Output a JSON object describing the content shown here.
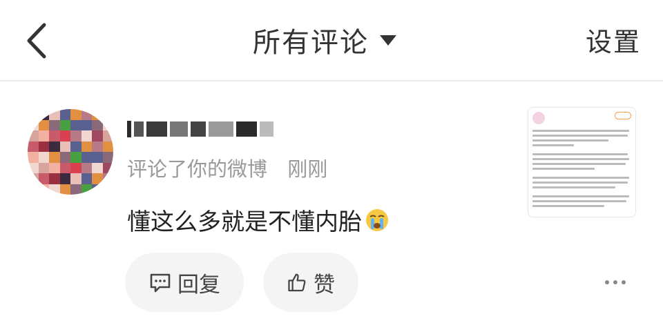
{
  "header": {
    "title": "所有评论",
    "settings_label": "设置",
    "back_icon": "chevron-left-icon",
    "dropdown_icon": "caret-down-icon"
  },
  "notification": {
    "meta_action": "评论了你的微博",
    "meta_time": "刚刚",
    "comment_text": "懂这么多就是不懂内胎",
    "comment_emoji": "crying-face-icon",
    "actions": {
      "reply_label": "回复",
      "like_label": "赞"
    },
    "more_icon": "more-dots-icon"
  },
  "colors": {
    "text_primary": "#333333",
    "text_secondary": "#999999",
    "pill_bg": "#f4f4f4",
    "divider": "#ececec",
    "accent_orange": "#e26a2c"
  }
}
